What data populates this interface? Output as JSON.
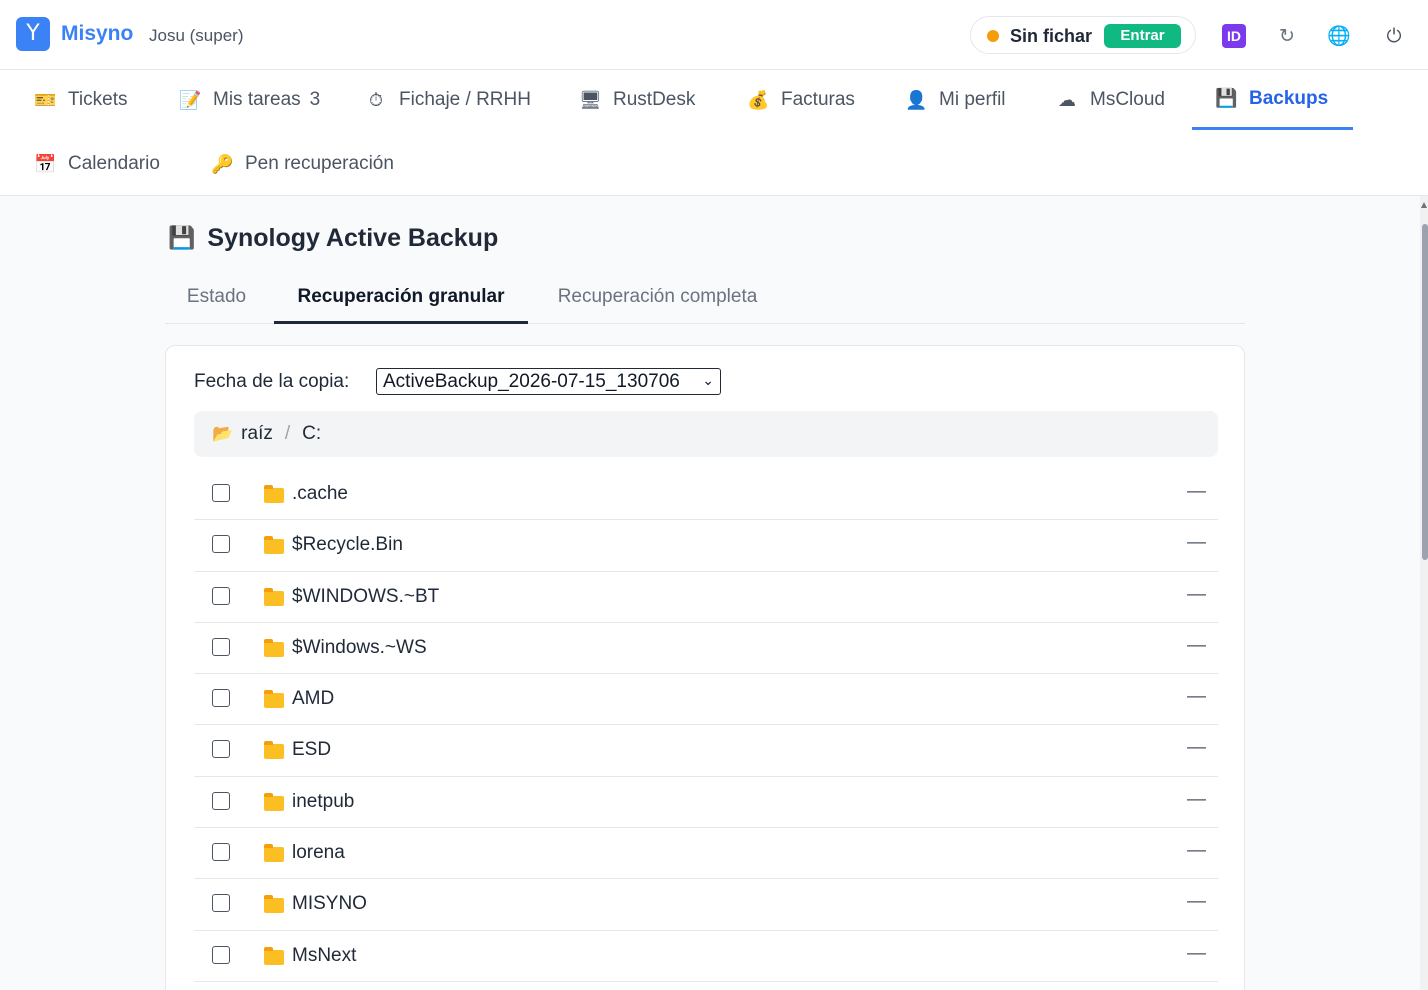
{
  "header": {
    "logo_glyph": "Y",
    "brand": "Misyno",
    "user": "Josu (super)",
    "clock_status": "Sin fichar",
    "clock_action": "Entrar",
    "id_label": "ID",
    "refresh_glyph": "↻",
    "globe_glyph": "🌐",
    "power_glyph": "⏻"
  },
  "nav": {
    "items": [
      {
        "label": "Tickets",
        "icon": "🎫"
      },
      {
        "label": "Mis tareas",
        "icon": "📝",
        "badge": "3"
      },
      {
        "label": "Fichaje / RRHH",
        "icon": "⏱"
      },
      {
        "label": "RustDesk",
        "icon": "🖥"
      },
      {
        "label": "Facturas",
        "icon": "💰"
      },
      {
        "label": "Mi perfil",
        "icon": "👤"
      },
      {
        "label": "MsCloud",
        "icon": "☁"
      },
      {
        "label": "Backups",
        "icon": "💾"
      },
      {
        "label": "Calendario",
        "icon": "📅"
      },
      {
        "label": "Pen recuperación",
        "icon": "🔑"
      }
    ]
  },
  "page": {
    "title": "Synology Active Backup",
    "title_icon": "💾",
    "tabs": [
      "Estado",
      "Recuperación granular",
      "Recuperación completa"
    ],
    "date_label": "Fecha de la copia:",
    "date_value": "ActiveBackup_2026-07-15_130706",
    "breadcrumb": {
      "root": "raíz",
      "sep": "/",
      "current": "C:"
    },
    "rows": [
      {
        "name": ".cache",
        "size": "—"
      },
      {
        "name": "$Recycle.Bin",
        "size": "—"
      },
      {
        "name": "$WINDOWS.~BT",
        "size": "—"
      },
      {
        "name": "$Windows.~WS",
        "size": "—"
      },
      {
        "name": "AMD",
        "size": "—"
      },
      {
        "name": "ESD",
        "size": "—"
      },
      {
        "name": "inetpub",
        "size": "—"
      },
      {
        "name": "lorena",
        "size": "—"
      },
      {
        "name": "MISYNO",
        "size": "—"
      },
      {
        "name": "MsNext",
        "size": "—"
      }
    ]
  },
  "colors": {
    "accent": "#3b82f6",
    "success": "#10b981",
    "warning": "#f59e0b",
    "folder": "#fbbf24"
  }
}
